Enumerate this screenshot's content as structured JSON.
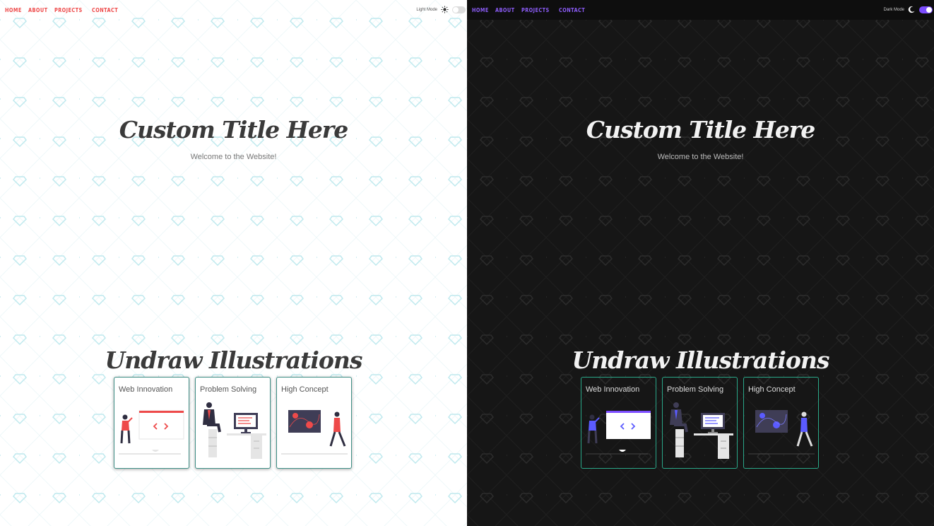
{
  "panels": [
    {
      "theme": "light",
      "nav": {
        "links": [
          "HOME",
          "ABOUT",
          "PROJECTS",
          "CONTACT"
        ]
      },
      "mode": {
        "label": "Light Mode",
        "icon": "sun-icon",
        "on": false
      },
      "hero": {
        "title": "Custom Title Here",
        "subtitle": "Welcome to the Website!"
      },
      "section": {
        "title": "Undraw Illustrations"
      },
      "cards": [
        {
          "title": "Web Innovation",
          "illustration": "web-innovation-illustration"
        },
        {
          "title": "Problem Solving",
          "illustration": "problem-solving-illustration"
        },
        {
          "title": "High Concept",
          "illustration": "high-concept-illustration"
        }
      ],
      "colors": {
        "accent": "#ee4a4a",
        "background": "#ffffff",
        "pattern": "#bfe9ee",
        "card_border": "#3f8f86"
      }
    },
    {
      "theme": "dark",
      "nav": {
        "links": [
          "HOME",
          "ABOUT",
          "PROJECTS",
          "CONTACT"
        ]
      },
      "mode": {
        "label": "Dark Mode",
        "icon": "moon-icon",
        "on": true
      },
      "hero": {
        "title": "Custom Title Here",
        "subtitle": "Welcome to the Website!"
      },
      "section": {
        "title": "Undraw Illustrations"
      },
      "cards": [
        {
          "title": "Web Innovation",
          "illustration": "web-innovation-illustration"
        },
        {
          "title": "Problem Solving",
          "illustration": "problem-solving-illustration"
        },
        {
          "title": "High Concept",
          "illustration": "high-concept-illustration"
        }
      ],
      "colors": {
        "accent": "#7c4dff",
        "background": "#161616",
        "pattern": "#2a2a2a",
        "card_border": "#2aa889"
      }
    }
  ]
}
